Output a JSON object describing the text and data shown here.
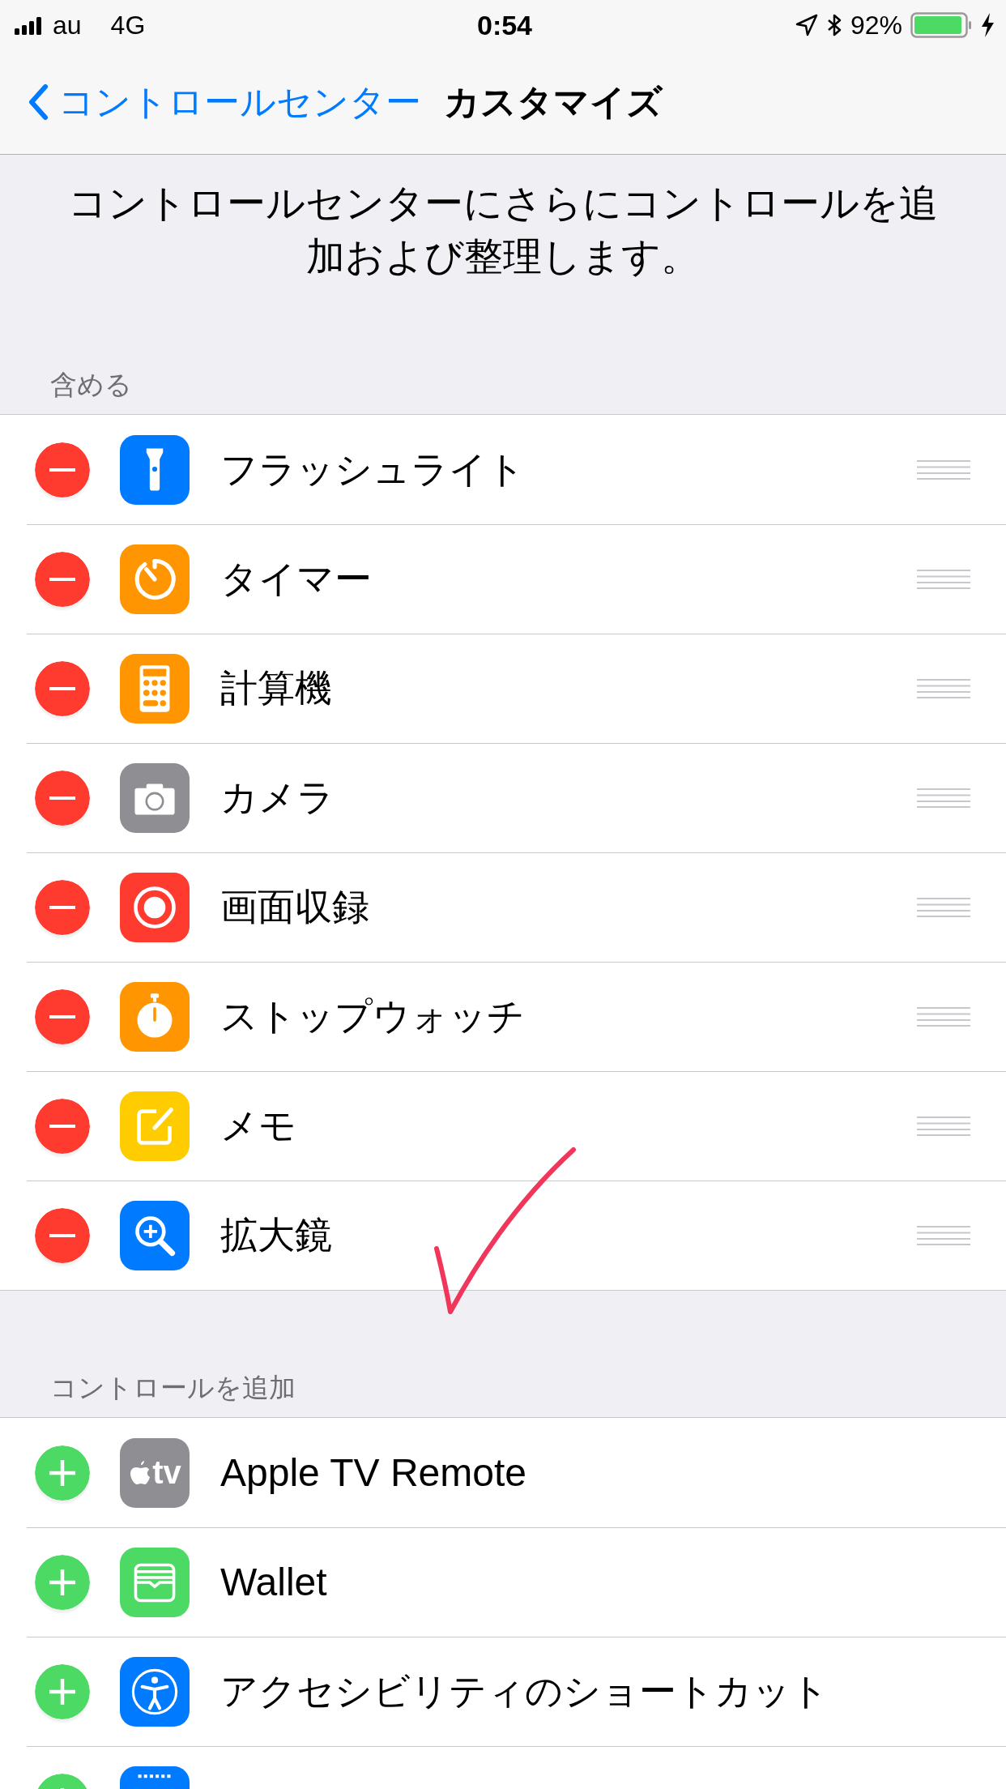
{
  "status_bar": {
    "carrier": "au",
    "network": "4G",
    "time": "0:54",
    "battery": "92%"
  },
  "nav": {
    "back": "コントロールセンター",
    "title": "カスタマイズ"
  },
  "description": "コントロールセンターにさらにコントロールを追加および整理します。",
  "sections": [
    {
      "header": "含める",
      "kind": "remove",
      "items": [
        {
          "label": "フラッシュライト",
          "kind": "flashlight",
          "color": "#007aff"
        },
        {
          "label": "タイマー",
          "kind": "timer",
          "color": "#ff9500"
        },
        {
          "label": "計算機",
          "kind": "calculator",
          "color": "#ff9500"
        },
        {
          "label": "カメラ",
          "kind": "camera",
          "color": "#8e8e93"
        },
        {
          "label": "画面収録",
          "kind": "record",
          "color": "#ff3b30"
        },
        {
          "label": "ストップウォッチ",
          "kind": "stopwatch",
          "color": "#ff9500"
        },
        {
          "label": "メモ",
          "kind": "notes",
          "color": "#ffcc00"
        },
        {
          "label": "拡大鏡",
          "kind": "magnifier",
          "color": "#007aff"
        }
      ]
    },
    {
      "header": "コントロールを追加",
      "kind": "add",
      "items": [
        {
          "label": "Apple TV Remote",
          "kind": "appletv",
          "color": "#8e8e93",
          "icon_text": "tv"
        },
        {
          "label": "Wallet",
          "kind": "wallet",
          "color": "#4cd964"
        },
        {
          "label": "アクセシビリティのショートカット",
          "kind": "accessibility",
          "color": "#007aff"
        },
        {
          "kind": "partial",
          "color": "#007aff"
        }
      ]
    }
  ],
  "annotation": {
    "kind": "checkmark"
  }
}
